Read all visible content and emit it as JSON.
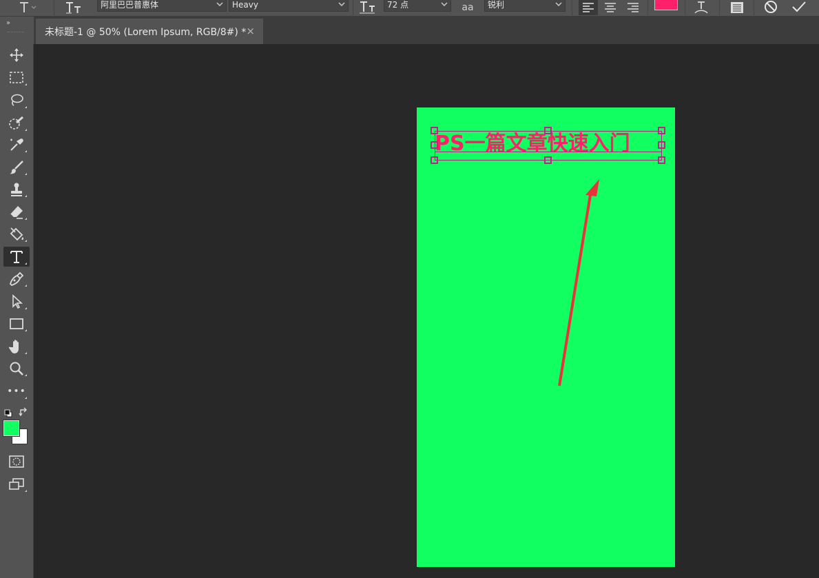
{
  "options_bar": {
    "font_family": "阿里巴巴普惠体",
    "font_style": "Heavy",
    "font_size": "72 点",
    "anti_alias_label": "aa",
    "anti_alias": "锐利",
    "text_color": "#ff1f6b"
  },
  "document_tab": {
    "title": "未标题-1 @ 50% (Lorem Ipsum, RGB/8#) *",
    "close": "×"
  },
  "toolbar": {
    "collapse": "››",
    "tools": [
      "move-tool",
      "rectangular-marquee-tool",
      "lasso-tool",
      "quick-selection-tool",
      "eyedropper-tool",
      "brush-tool",
      "clone-stamp-tool",
      "eraser-tool",
      "paint-bucket-tool",
      "type-tool",
      "pen-tool",
      "path-selection-tool",
      "rectangle-tool",
      "hand-tool",
      "zoom-tool",
      "more-tools"
    ],
    "active_tool": "type-tool",
    "more_label": "•••",
    "foreground_color": "#12ff62",
    "background_color": "#ffffff"
  },
  "canvas": {
    "document_color": "#12ff62",
    "headline": "PS一篇文章快速入门"
  }
}
